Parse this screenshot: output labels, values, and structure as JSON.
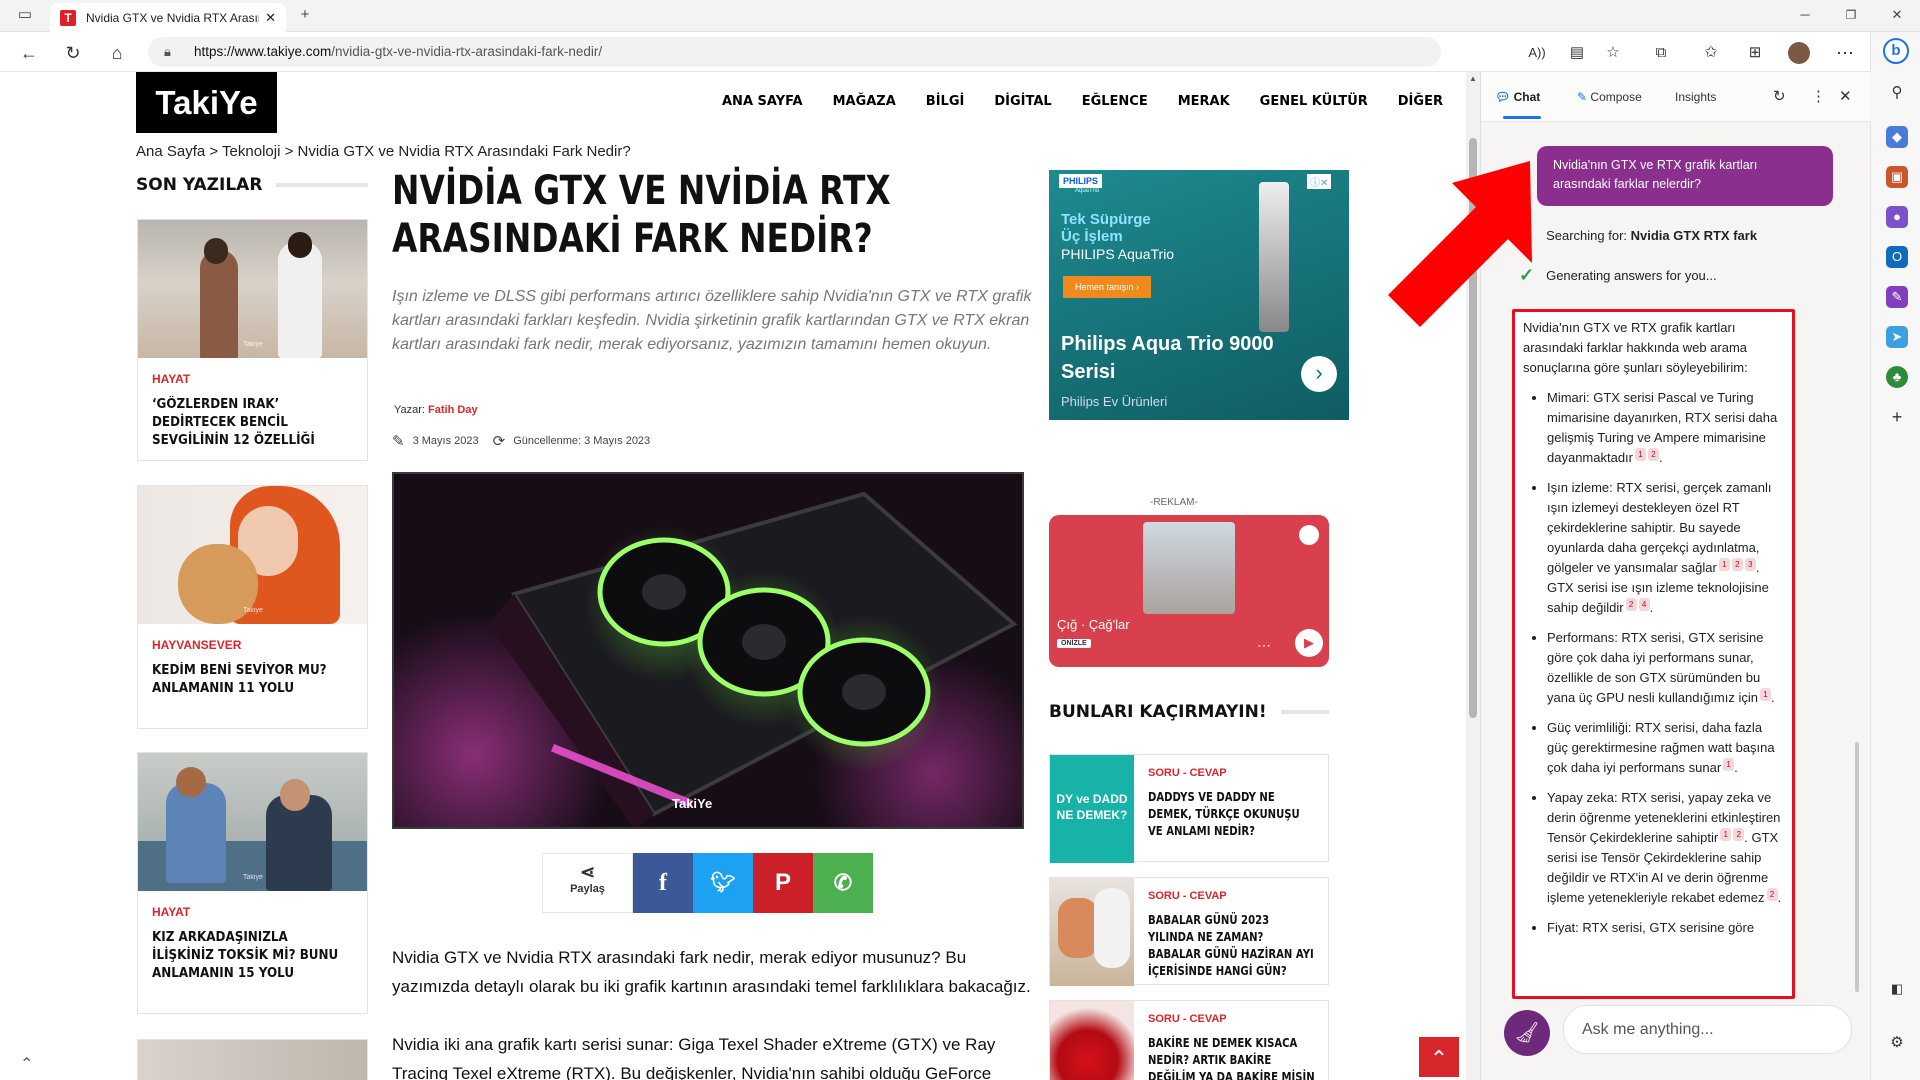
{
  "browser": {
    "tab_title": "Nvidia GTX ve Nvidia RTX Arasında",
    "tab_favicon": "T",
    "url_host": "https://www.takiye.com",
    "url_path": "/nvidia-gtx-ve-nvidia-rtx-arasindaki-fark-nedir/",
    "icons": [
      "back-icon",
      "refresh-icon",
      "home-icon",
      "read-aloud-icon",
      "immersive-reader-icon",
      "add-favorite-icon",
      "extensions-icon",
      "favorites-icon",
      "collections-icon",
      "profile-avatar",
      "more-icon",
      "bing-copilot-icon"
    ]
  },
  "site": {
    "logo": "TakiYe",
    "nav": [
      "ANA SAYFA",
      "MAĞAZA",
      "BİLGİ",
      "DİGİTAL",
      "EĞLENCE",
      "MERAK",
      "GENEL KÜLTÜR",
      "DİĞER"
    ],
    "breadcrumb": "Ana Sayfa > Teknoloji > Nvidia GTX ve Nvidia RTX Arasındaki Fark Nedir?"
  },
  "sidebar": {
    "heading": "SON YAZILAR",
    "cards": [
      {
        "category": "HAYAT",
        "title": "‘GÖZLERDEN IRAK’ DEDİRTECEK BENCİL SEVGİLİNİN 12 ÖZELLİĞİ"
      },
      {
        "category": "HAYVANSEVER",
        "title": "KEDİM BENİ SEVİYOR MU? ANLAMANIN 11 YOLU"
      },
      {
        "category": "HAYAT",
        "title": "KIZ ARKADAŞINIZLA İLİŞKİNİZ TOKSİK Mİ? BUNU ANLAMANIN 15 YOLU"
      }
    ]
  },
  "article": {
    "title": "NVİDİA GTX VE NVİDİA RTX ARASINDAKİ FARK NEDİR?",
    "subtitle": "Işın izleme ve DLSS gibi performans artırıcı özelliklere sahip Nvidia'nın GTX ve RTX grafik kartları arasındaki farkları keşfedin. Nvidia şirketinin grafik kartlarından GTX ve RTX ekran kartları arasındaki fark nedir, merak ediyorsanız, yazımızın tamamını hemen okuyun.",
    "author_label": "Yazar:",
    "author": "Fatih Day",
    "date": "3 Mayıs 2023",
    "updated": "Güncellenme: 3 Mayıs 2023",
    "image_watermark": "TakiYe",
    "share_label": "Paylaş",
    "body1": "Nvidia GTX ve Nvidia RTX arasındaki fark nedir, merak ediyor musunuz? Bu yazımızda detaylı olarak bu iki grafik kartının arasındaki temel farklılıklara bakacağız.",
    "body2": "Nvidia iki ana grafik kartı serisi sunar: Giga Texel Shader eXtreme (GTX) ve Ray Tracing Texel eXtreme (RTX). Bu değişkenler, Nvidia'nın sahibi olduğu GeForce markasının"
  },
  "ads": {
    "brand": "PHILIPS",
    "tag": "AquaTrio",
    "line1": "Tek Süpürge",
    "line2": "Üç İşlem",
    "product": "PHILIPS AquaTrio",
    "cta": "Hemen tanışın ›",
    "headline": "Philips Aqua Trio 9000 Serisi",
    "sponsor": "Philips Ev Ürünleri",
    "reklam": "-REKLAM-",
    "spotify_track": "Çığ · Çağ'lar",
    "spotify_badge": "ÖNİZLE"
  },
  "promo": {
    "heading": "BUNLARI KAÇIRMAYIN!",
    "items": [
      {
        "category": "SORU - CEVAP",
        "title": "DADDYS VE DADDY NE DEMEK, TÜRKÇE OKUNUŞU VE ANLAMI NEDİR?",
        "thumb_text": "DY ve DADD NE DEMEK?"
      },
      {
        "category": "SORU - CEVAP",
        "title": "BABALAR GÜNÜ 2023 YILINDA NE ZAMAN? BABALAR GÜNÜ HAZİRAN AYI İÇERİSİNDE HANGİ GÜN?"
      },
      {
        "category": "SORU - CEVAP",
        "title": "BAKİRE NE DEMEK KISACA NEDİR? ARTIK BAKİRE DEĞİLİM YA DA BAKİRE MİSİN SORUSU"
      }
    ]
  },
  "copilot": {
    "tabs": [
      "Chat",
      "Compose",
      "Insights"
    ],
    "user_message": "Nvidia'nın GTX ve RTX grafik kartları arasındaki farklar nelerdir?",
    "searching_prefix": "Searching for: ",
    "searching_query": "Nvidia GTX RTX fark",
    "generating": "Generating answers for you...",
    "answer_intro": "Nvidia'nın GTX ve RTX grafik kartları arasındaki farklar hakkında web arama sonuçlarına göre şunları söyleyebilirim:",
    "bullets": [
      {
        "text": "Mimari: GTX serisi Pascal ve Turing mimarisine dayanırken, RTX serisi daha gelişmiş Turing ve Ampere mimarisine dayanmaktadır",
        "cites": [
          "1",
          "2"
        ],
        "tail": ".",
        "extra": "",
        "cites2": [],
        "tail2": ""
      },
      {
        "text": "Işın izleme: RTX serisi, gerçek zamanlı ışın izlemeyi destekleyen özel RT çekirdeklerine sahiptir. Bu sayede oyunlarda daha gerçekçi aydınlatma, gölgeler ve yansımalar sağlar",
        "cites": [
          "1",
          "2",
          "3"
        ],
        "tail": ".",
        "extra": " GTX serisi ise ışın izleme teknolojisine sahip değildir",
        "cites2": [
          "2",
          "4"
        ],
        "tail2": "."
      },
      {
        "text": "Performans: RTX serisi, GTX serisine göre çok daha iyi performans sunar, özellikle de son GTX sürümünden bu yana üç GPU nesli kullandığımız için",
        "cites": [
          "1"
        ],
        "tail": ".",
        "extra": "",
        "cites2": [],
        "tail2": ""
      },
      {
        "text": "Güç verimliliği: RTX serisi, daha fazla güç gerektirmesine rağmen watt başına çok daha iyi performans sunar",
        "cites": [
          "1"
        ],
        "tail": ".",
        "extra": "",
        "cites2": [],
        "tail2": ""
      },
      {
        "text": "Yapay zeka: RTX serisi, yapay zeka ve derin öğrenme yeteneklerini etkinleştiren Tensör Çekirdeklerine sahiptir",
        "cites": [
          "1",
          "2"
        ],
        "tail": ".",
        "extra": " GTX serisi ise Tensör Çekirdeklerine sahip değildir ve RTX'in AI ve derin öğrenme işleme yetenekleriyle rekabet edemez",
        "cites2": [
          "2"
        ],
        "tail2": "."
      },
      {
        "text": "Fiyat: RTX serisi, GTX serisine göre",
        "cites": [],
        "tail": "",
        "extra": "",
        "cites2": [],
        "tail2": ""
      }
    ],
    "input_placeholder": "Ask me anything..."
  },
  "colors": {
    "accent_red": "#d7262c",
    "copilot_purple": "#8a2f8e",
    "highlight_border": "#e60f1e"
  }
}
